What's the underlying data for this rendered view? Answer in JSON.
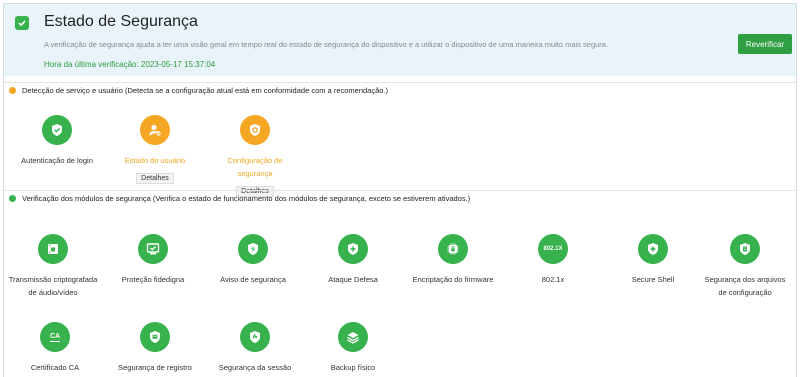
{
  "header": {
    "title": "Estado de Segurança",
    "description": "A verificação de segurança ajuda a ter uma visão geral em tempo real do estado de segurança do dispositivo e a utilizar o dispositivo de uma maneira muito mais segura.",
    "last_check": "Hora da última verificação: 2023-05-17 15:37:04",
    "reverify_label": "Reverificar"
  },
  "section_service": {
    "title": "Detecção de serviço e usuário (Detecta se a configuração atual está em conformidade com a recomendação.)",
    "items": [
      {
        "label": "Autenticação de login",
        "status": "ok",
        "icon": "shield-check-icon"
      },
      {
        "label": "Estado do usuário",
        "status": "warning",
        "icon": "user-icon",
        "details": "Detalhes"
      },
      {
        "label": "Configuração de segurança",
        "status": "warning",
        "icon": "shield-gear-icon",
        "details": "Detalhes"
      }
    ]
  },
  "section_modules": {
    "title": "Verificação dos módulos de segurança (Verifica o estado de funcionamento dos módulos de segurança, exceto se estiverem ativados.)",
    "items": [
      {
        "label": "Transmissão criptografada de áudio/vídeo",
        "icon": "encrypted-video-icon"
      },
      {
        "label": "Proteção fidedigna",
        "icon": "trusted-monitor-icon"
      },
      {
        "label": "Aviso de segurança",
        "icon": "lightning-shield-icon"
      },
      {
        "label": "Ataque Defesa",
        "icon": "plus-shield-icon"
      },
      {
        "label": "Encriptação do firmware",
        "icon": "chip-lock-icon"
      },
      {
        "label": "802.1x",
        "icon": "802-1x-icon",
        "icon_text": "802.1X"
      },
      {
        "label": "Secure Shell",
        "icon": "shell-shield-icon"
      },
      {
        "label": "Segurança dos arquivos de configuração",
        "icon": "file-shield-icon"
      },
      {
        "label": "Certificado CA",
        "icon": "ca-certificate-icon",
        "icon_text": "CA"
      },
      {
        "label": "Segurança de registro",
        "icon": "log-shield-icon"
      },
      {
        "label": "Segurança da sessão",
        "icon": "session-shield-icon"
      },
      {
        "label": "Backup físico",
        "icon": "layers-icon"
      }
    ]
  },
  "colors": {
    "ok": "#37b24d",
    "warning": "#f5a623",
    "header_bg": "#e8f4fa",
    "button": "#2ea043"
  }
}
